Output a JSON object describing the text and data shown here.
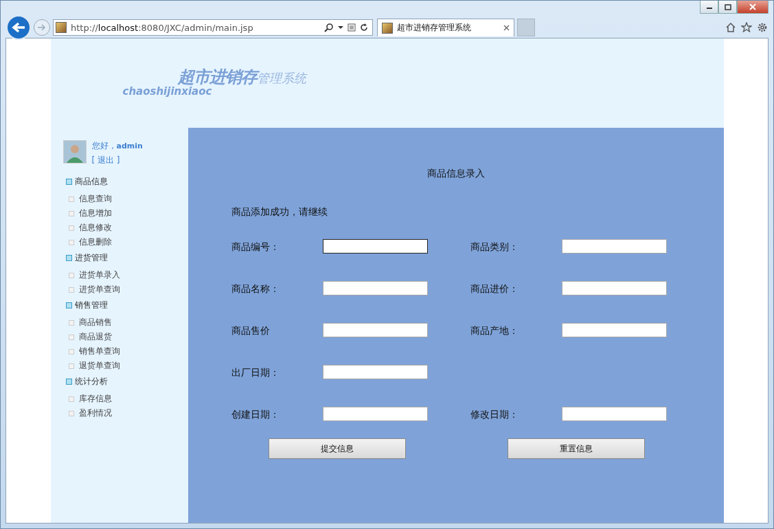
{
  "browser": {
    "address": "http://**localhost**:8080/JXC/admin/main.jsp",
    "tab_title": "超市进销存管理系统"
  },
  "header": {
    "logo_main": "超市进销存",
    "logo_sub": "管理系统",
    "logo_pinyin": "chaoshijinxiaoc"
  },
  "user": {
    "greeting": "您好，**admin**",
    "logout": "[ 退出 ]"
  },
  "sidebar": [
    {
      "label": "商品信息",
      "children": [
        {
          "label": "信息查询"
        },
        {
          "label": "信息增加"
        },
        {
          "label": "信息修改"
        },
        {
          "label": "信息删除"
        }
      ]
    },
    {
      "label": "进货管理",
      "children": [
        {
          "label": "进货单录入"
        },
        {
          "label": "进货单查询"
        }
      ]
    },
    {
      "label": "销售管理",
      "children": [
        {
          "label": "商品销售"
        },
        {
          "label": "商品退货"
        },
        {
          "label": "销售单查询"
        },
        {
          "label": "退货单查询"
        }
      ]
    },
    {
      "label": "统计分析",
      "children": [
        {
          "label": "库存信息"
        },
        {
          "label": "盈利情况"
        }
      ]
    }
  ],
  "form": {
    "title": "商品信息录入",
    "message": "商品添加成功，请继续",
    "rows": [
      [
        {
          "label": "商品编号：",
          "focused": true
        },
        {
          "label": "商品类别：",
          "focused": false
        }
      ],
      [
        {
          "label": "商品名称：",
          "focused": false
        },
        {
          "label": "商品进价：",
          "focused": false
        }
      ],
      [
        {
          "label": "商品售价",
          "focused": false
        },
        {
          "label": "商品产地：",
          "focused": false
        }
      ],
      [
        {
          "label": "出厂日期：",
          "focused": false
        }
      ],
      [
        {
          "label": "创建日期：",
          "focused": false
        },
        {
          "label": "修改日期：",
          "focused": false
        }
      ]
    ],
    "buttons": [
      "提交信息",
      "重置信息"
    ]
  }
}
